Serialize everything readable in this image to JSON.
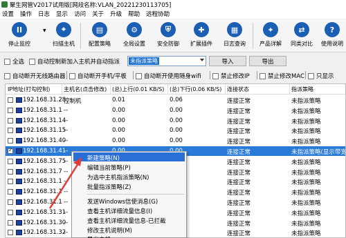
{
  "window": {
    "title": "聚生网管V2017试用版[网段名称:VLAN_20221230113705]"
  },
  "menu": [
    "设置",
    "操作",
    "日志",
    "显示",
    "访问",
    "关于",
    "升级",
    "帮助",
    "远程协助"
  ],
  "toolbar": [
    {
      "label": "停止监控",
      "icon": "pause-icon",
      "glyph": "II"
    },
    {
      "label": "扫描主机",
      "icon": "scan-hosts-icon",
      "glyph": "⌖"
    },
    {
      "label": "配置策略",
      "icon": "configure-policy-icon",
      "glyph": "▤"
    },
    {
      "label": "全局设置",
      "icon": "global-settings-icon",
      "glyph": "⚙"
    },
    {
      "label": "安全防御",
      "icon": "shield-icon",
      "glyph": "⛨"
    },
    {
      "label": "扩展插件",
      "icon": "plugin-icon",
      "glyph": "✚"
    },
    {
      "label": "日志查询",
      "icon": "log-icon",
      "glyph": "▦"
    },
    {
      "label": "产品详解",
      "icon": "product-info-icon",
      "glyph": "✦"
    },
    {
      "label": "同类对比",
      "icon": "compare-icon",
      "glyph": "⇄"
    },
    {
      "label": "使用说明",
      "icon": "help-icon",
      "glyph": "?"
    }
  ],
  "options_row1": {
    "select_all": "全选",
    "auto_control": "自动控制新加入主机并自动指派",
    "policy_selected": "未指派策略",
    "import": "导入",
    "export": "导出"
  },
  "options_row2": [
    "自动断开无线路由器",
    "自动断开手机/平板",
    "自动断开使用随身wifi",
    "禁止修改IP",
    "禁止修改MAC",
    "只显示"
  ],
  "table": {
    "headers": [
      "IP地址(打勾控制)",
      "主机名(点击修改)",
      "(总)上行(0.01 KB/S)",
      "(总)下行(0.06 KB/S)",
      "连接状态",
      "指派策略"
    ],
    "rows": [
      {
        "ip": "192.168.31.28",
        "host": "控制机",
        "up": "0.01",
        "down": "0.06",
        "status": "连接正常",
        "policy": "未指派策略",
        "checked": false,
        "selected": false
      },
      {
        "ip": "192.168.31.1",
        "host": "--",
        "up": "0.00",
        "down": "0.00",
        "status": "连接正常",
        "policy": "未指派策略",
        "checked": false,
        "selected": false
      },
      {
        "ip": "192.168.31.14",
        "host": "--",
        "up": "0.00",
        "down": "0.00",
        "status": "连接正常",
        "policy": "未指派策略",
        "checked": false,
        "selected": false
      },
      {
        "ip": "192.168.31.15",
        "host": "--",
        "up": "0.00",
        "down": "0.00",
        "status": "连接正常",
        "policy": "未指派策略",
        "checked": false,
        "selected": false
      },
      {
        "ip": "192.168.31.40",
        "host": "--",
        "up": "0.00",
        "down": "0.00",
        "status": "连接正常",
        "policy": "未指派策略",
        "checked": false,
        "selected": false
      },
      {
        "ip": "192.168.31.41",
        "host": "--",
        "up": "0.00",
        "down": "0.00",
        "status": "连接正常",
        "policy": "未指派策略(显示带宽",
        "checked": true,
        "selected": true
      },
      {
        "ip": "192.168.31.75",
        "host": "--",
        "up": "",
        "down": "",
        "status": "连接正常",
        "policy": "未指派策略",
        "checked": false,
        "selected": false
      },
      {
        "ip": "192.168.31.7",
        "host": "--",
        "up": "",
        "down": "",
        "status": "连接正常",
        "policy": "未指派策略",
        "checked": false,
        "selected": false
      },
      {
        "ip": "192.168.31.1",
        "host": "--",
        "up": "",
        "down": "",
        "status": "连接正常",
        "policy": "未指派策略",
        "checked": false,
        "selected": false
      },
      {
        "ip": "192.168.31.1",
        "host": "--",
        "up": "",
        "down": "",
        "status": "连接正常",
        "policy": "未指派策略",
        "checked": false,
        "selected": false
      },
      {
        "ip": "192.168.31.1",
        "host": "--",
        "up": "",
        "down": "",
        "status": "连接正常",
        "policy": "未指派策略",
        "checked": false,
        "selected": false
      },
      {
        "ip": "192.168.31.31",
        "host": "--",
        "up": "",
        "down": "",
        "status": "连接正常",
        "policy": "未指派策略",
        "checked": false,
        "selected": false
      },
      {
        "ip": "192.168.31.30",
        "host": "--",
        "up": "",
        "down": "",
        "status": "连接正常",
        "policy": "未指派策略",
        "checked": false,
        "selected": false
      },
      {
        "ip": "192.168.31.32",
        "host": "--",
        "up": "",
        "down": "",
        "status": "连接正常",
        "policy": "未指派策略",
        "checked": false,
        "selected": false
      }
    ]
  },
  "context_menu": {
    "items": [
      "新建策略(N)",
      "编辑当前策略(P)",
      "为选中主机指派策略(N)",
      "批量指派策略(Z)",
      "发送Windows信使消息(G)",
      "查看主机详细流量信息(I)",
      "查看主机详细流量信息-已拦截",
      "修改主机说明(M)",
      "导出主机..."
    ],
    "highlighted": 0
  },
  "colors": {
    "selection": "#2a7ad8",
    "toolbar_icon": "#1a5fb4",
    "annotation_arrow": "#e53935"
  }
}
